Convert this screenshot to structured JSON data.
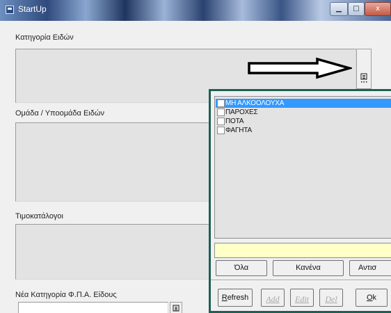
{
  "window": {
    "title": "StartUp",
    "controls": {
      "minimize": "▁",
      "maximize": "□",
      "close": "x"
    }
  },
  "sections": {
    "item_category": {
      "label": "Κατηγορία Ειδών",
      "picker_icon": "list-icon"
    },
    "item_group": {
      "label": "Ομάδα / Υποομάδα Ειδών"
    },
    "price_lists": {
      "label": "Τιμοκατάλογοι"
    },
    "vat_category": {
      "label": "Νέα Κατηγορία Φ.Π.Α. Είδους",
      "value": "",
      "picker_icon": "list-icon"
    }
  },
  "popup": {
    "items": [
      {
        "label": "ΜΗ ΑΛΚΟΟΛΟΥΧΑ",
        "checked": false,
        "selected": true
      },
      {
        "label": "ΠΑΡΟΧΕΣ",
        "checked": false,
        "selected": false
      },
      {
        "label": "ΠΟΤΑ",
        "checked": false,
        "selected": false
      },
      {
        "label": "ΦΑΓΗΤΑ",
        "checked": false,
        "selected": false
      }
    ],
    "filter_value": "",
    "buttons": {
      "all": "Όλα",
      "none": "Κανένα",
      "invert": "Αντισ",
      "refresh_first": "R",
      "refresh_rest": "efresh",
      "add": "Add",
      "edit": "Edit",
      "del": "Del",
      "ok_first": "O",
      "ok_rest": "k"
    }
  },
  "colors": {
    "selection": "#3399ff",
    "popup_border": "#1e5f54",
    "filter_background": "#ffffc8"
  }
}
